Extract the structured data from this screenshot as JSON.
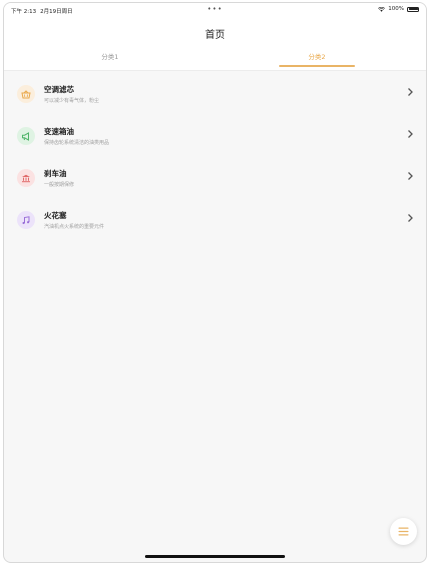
{
  "status_bar": {
    "time": "下午 2:13",
    "date": "2月19日周日",
    "dots": "•••",
    "battery": "100%"
  },
  "header": {
    "title": "首页",
    "tabs": [
      {
        "label": "分类1",
        "active": false
      },
      {
        "label": "分类2",
        "active": true
      }
    ]
  },
  "list": {
    "items": [
      {
        "title": "空调滤芯",
        "subtitle": "可以减少有毒气体，粉尘",
        "icon": "basket-icon",
        "icon_bg": "#fbeedc",
        "icon_color": "#e9a84a"
      },
      {
        "title": "变速箱油",
        "subtitle": "保持齿轮系统清洁的油类用品",
        "icon": "megaphone-icon",
        "icon_bg": "#dff3e3",
        "icon_color": "#4fb469"
      },
      {
        "title": "刹车油",
        "subtitle": "一般按期保修",
        "icon": "bank-icon",
        "icon_bg": "#fbe2e2",
        "icon_color": "#e06a6a"
      },
      {
        "title": "火花塞",
        "subtitle": "汽油机点火系统的重要元件",
        "icon": "music-note-icon",
        "icon_bg": "#ece3fa",
        "icon_color": "#9a6fd8"
      }
    ]
  },
  "fab": {
    "icon": "menu-icon",
    "color": "#e9b466"
  },
  "colors": {
    "accent": "#e9a84a"
  }
}
